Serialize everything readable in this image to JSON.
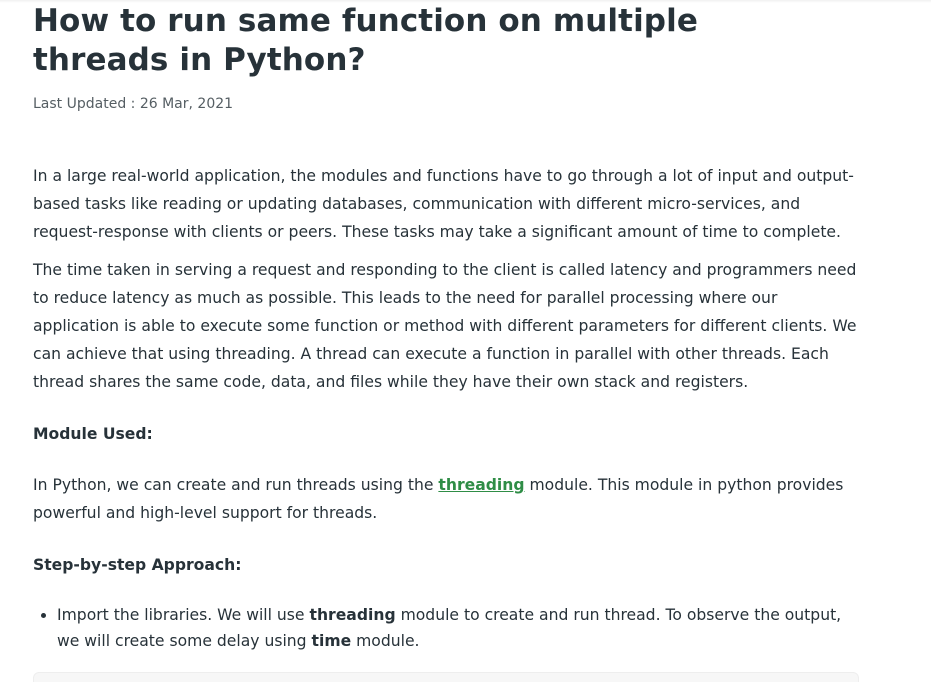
{
  "article": {
    "title": "How to run same function on multiple threads in Python?",
    "last_updated_label": "Last Updated :",
    "last_updated_value": "26 Mar, 2021",
    "paragraph_1": "In a large real-world application, the modules and functions have to go through a lot of input and output-based tasks like reading or updating databases, communication with different micro-services, and request-response with clients or peers. These tasks may take a significant amount of time to complete.",
    "paragraph_2": "The time taken in serving a request and responding to the client is called latency and programmers need to reduce latency as much as possible. This leads to the need for parallel processing where our application is able to execute some function or method with different parameters for different clients. We can achieve that using threading. A thread can execute a function in parallel with other threads. Each thread shares the same code, data, and files while they have their own stack and registers.",
    "module_heading": "Module Used:",
    "module_text_before": "In Python, we can create and run threads using the ",
    "module_link": "threading",
    "module_text_after": " module. This module in python provides powerful and high-level support for threads.",
    "approach_heading": "Step-by-step Approach:",
    "steps": [
      {
        "before": "Import the libraries. We will use ",
        "bold_1": "threading",
        "middle": " module to create and run thread. To observe the output, we will create some delay using ",
        "bold_2": "time",
        "after": " module."
      }
    ]
  },
  "colors": {
    "text": "#273239",
    "meta": "#555e63",
    "link": "#2f8d46"
  }
}
